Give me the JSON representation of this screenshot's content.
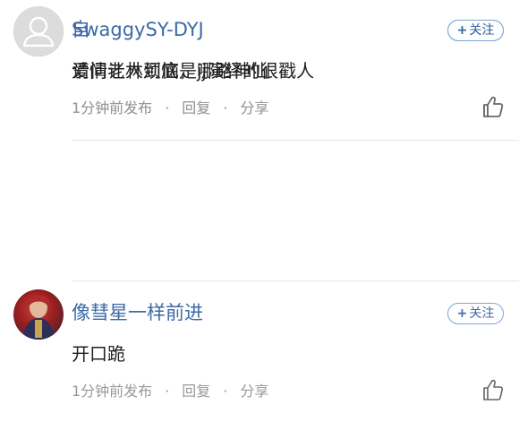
{
  "comments": [
    {
      "username": "SwaggySY-DYJ",
      "follow_label": "关注",
      "text": "请问老林到底是哪路神仙",
      "time": "1分钟前发布",
      "reply_label": "回复",
      "share_label": "分享",
      "avatar": "user-avatar-photo"
    },
    {
      "username": "像彗星一样前进",
      "follow_label": "关注",
      "text": "开口跪",
      "time": "1分钟前发布",
      "reply_label": "回复",
      "share_label": "分享",
      "avatar": "user-avatar-photo"
    },
    {
      "username": "自",
      "follow_label": "关注",
      "text": "爱情让人烦恼，jj演绎的很戳人",
      "time": "1分钟前发布",
      "reply_label": "回复",
      "share_label": "分享",
      "avatar": "default-avatar-icon"
    }
  ],
  "separators": {
    "dot": "·",
    "plus": "+"
  },
  "colors": {
    "username": "#3d6aa6",
    "text": "#222222",
    "meta": "#999999",
    "follow_border": "#7fa6d6"
  },
  "icons": {
    "like": "thumbs-up-icon",
    "default_avatar": "person-silhouette-icon"
  }
}
